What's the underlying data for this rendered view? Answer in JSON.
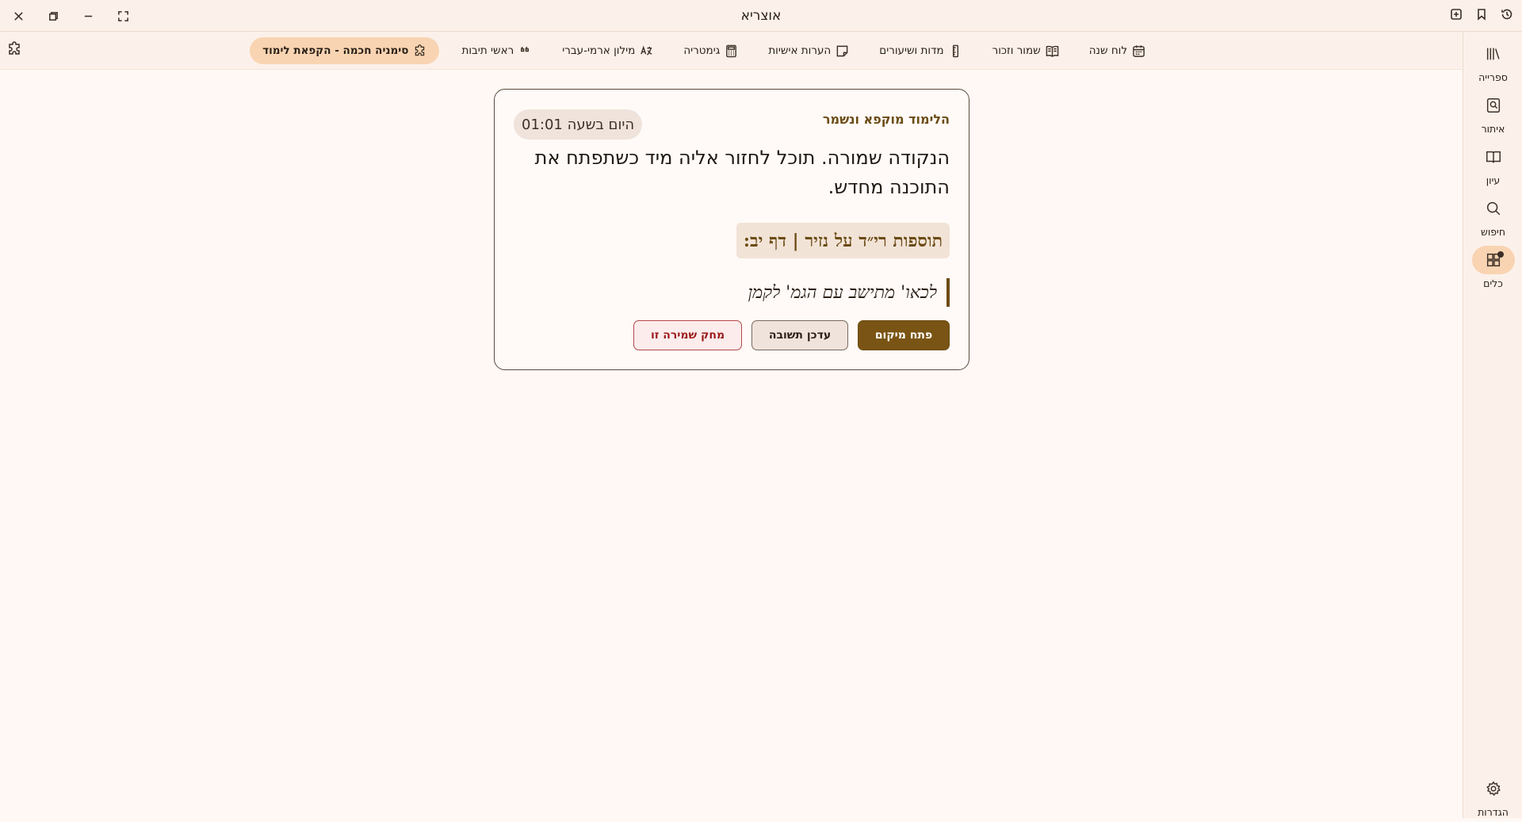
{
  "window": {
    "title": "אוצריא"
  },
  "toolbar": {
    "tools": [
      {
        "label": "לוח שנה",
        "icon": "calendar-icon"
      },
      {
        "label": "שמור וזכור",
        "icon": "open-book-icon"
      },
      {
        "label": "מדות ושיעורים",
        "icon": "ruler-icon"
      },
      {
        "label": "הערות אישיות",
        "icon": "sticky-note-icon"
      },
      {
        "label": "גימטריה",
        "icon": "calculator-icon"
      },
      {
        "label": "מילון ארמי-עברי",
        "icon": "translate-icon"
      },
      {
        "label": "ראשי תיבות",
        "icon": "quote-icon"
      },
      {
        "label": "סימניה חכמה - הקפאת לימוד",
        "icon": "puzzle-icon",
        "active": true
      }
    ]
  },
  "sidebar": {
    "items": [
      {
        "label": "ספרייה",
        "icon": "library-icon"
      },
      {
        "label": "איתור",
        "icon": "find-book-icon"
      },
      {
        "label": "עיון",
        "icon": "book-open-icon"
      },
      {
        "label": "חיפוש",
        "icon": "search-icon"
      },
      {
        "label": "כלים",
        "icon": "tools-grid-icon",
        "active": true
      },
      {
        "label": "הגדרות",
        "icon": "gear-icon"
      }
    ]
  },
  "card": {
    "heading": "הלימוד מוקפא ונשמר",
    "time": "היום בשעה 01:01",
    "message": "הנקודה שמורה. תוכל לחזור אליה מיד כשתפתח את התוכנה מחדש.",
    "source": "תוספות רי״ד על נזיר | דף יב:",
    "quote": "לכאו' מתישב עם הגמ' לקמן",
    "buttons": {
      "open": "פתח מיקום",
      "update": "עדכן תשובה",
      "delete": "מחק שמירה זו"
    }
  },
  "colors": {
    "accent": "#7a5414",
    "active_bg": "#f9d4b2",
    "background": "#fff8f4"
  }
}
